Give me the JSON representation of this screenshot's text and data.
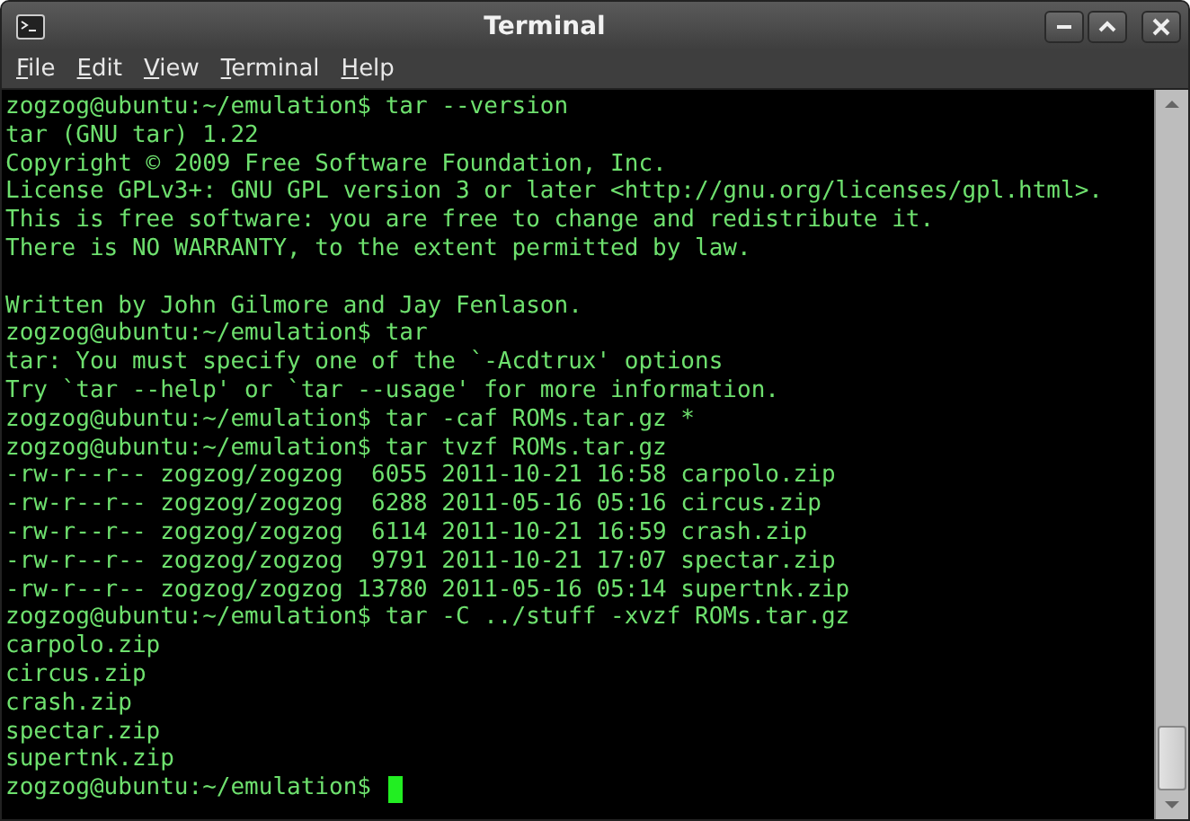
{
  "window": {
    "title": "Terminal"
  },
  "menu": [
    "File",
    "Edit",
    "View",
    "Terminal",
    "Help"
  ],
  "terminal": {
    "paragraphs": [
      [
        "zogzog@ubuntu:~/emulation$ tar --version",
        "tar (GNU tar) 1.22",
        "Copyright © 2009 Free Software Foundation, Inc.",
        "License GPLv3+: GNU GPL version 3 or later <http://gnu.org/licenses/gpl.html>.",
        "This is free software: you are free to change and redistribute it.",
        "There is NO WARRANTY, to the extent permitted by law."
      ],
      [
        "Written by John Gilmore and Jay Fenlason.",
        "zogzog@ubuntu:~/emulation$ tar",
        "tar: You must specify one of the `-Acdtrux' options",
        "Try `tar --help' or `tar --usage' for more information.",
        "zogzog@ubuntu:~/emulation$ tar -caf ROMs.tar.gz *",
        "zogzog@ubuntu:~/emulation$ tar tvzf ROMs.tar.gz",
        "-rw-r--r-- zogzog/zogzog  6055 2011-10-21 16:58 carpolo.zip",
        "-rw-r--r-- zogzog/zogzog  6288 2011-05-16 05:16 circus.zip",
        "-rw-r--r-- zogzog/zogzog  6114 2011-10-21 16:59 crash.zip",
        "-rw-r--r-- zogzog/zogzog  9791 2011-10-21 17:07 spectar.zip",
        "-rw-r--r-- zogzog/zogzog 13780 2011-05-16 05:14 supertnk.zip",
        "zogzog@ubuntu:~/emulation$ tar -C ../stuff -xvzf ROMs.tar.gz",
        "carpolo.zip",
        "circus.zip",
        "crash.zip",
        "spectar.zip",
        "supertnk.zip",
        "zogzog@ubuntu:~/emulation$"
      ]
    ],
    "cursor_visible": true
  }
}
